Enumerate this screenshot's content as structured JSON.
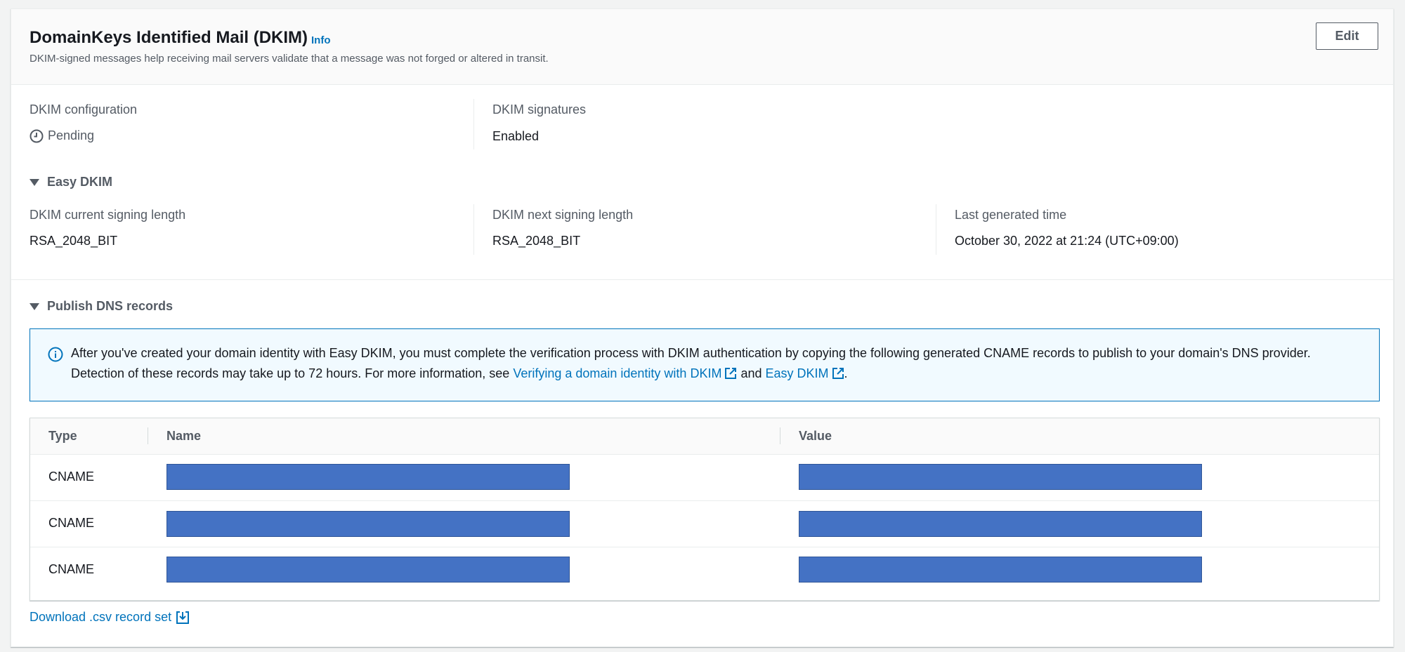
{
  "header": {
    "title": "DomainKeys Identified Mail (DKIM)",
    "info_link": "Info",
    "description": "DKIM-signed messages help receiving mail servers validate that a message was not forged or altered in transit.",
    "edit_label": "Edit"
  },
  "details": {
    "config_label": "DKIM configuration",
    "config_status": "Pending",
    "signatures_label": "DKIM signatures",
    "signatures_value": "Enabled"
  },
  "easy_dkim": {
    "toggle_label": "Easy DKIM",
    "current_length_label": "DKIM current signing length",
    "current_length_value": "RSA_2048_BIT",
    "next_length_label": "DKIM next signing length",
    "next_length_value": "RSA_2048_BIT",
    "last_generated_label": "Last generated time",
    "last_generated_value": "October 30, 2022 at 21:24 (UTC+09:00)"
  },
  "publish": {
    "toggle_label": "Publish DNS records",
    "alert_text_1": "After you've created your domain identity with Easy DKIM, you must complete the verification process with DKIM authentication by copying the following generated CNAME records to publish to your domain's DNS provider. Detection of these records may take up to 72 hours. For more information, see ",
    "alert_link_1": "Verifying a domain identity with DKIM",
    "alert_and": " and ",
    "alert_link_2": "Easy DKIM",
    "alert_end": ".",
    "table": {
      "headers": [
        "Type",
        "Name",
        "Value"
      ],
      "rows": [
        {
          "type": "CNAME"
        },
        {
          "type": "CNAME"
        },
        {
          "type": "CNAME"
        }
      ]
    },
    "download_label": "Download .csv record set"
  },
  "colors": {
    "link": "#0073bb",
    "redaction": "#4472c4"
  }
}
